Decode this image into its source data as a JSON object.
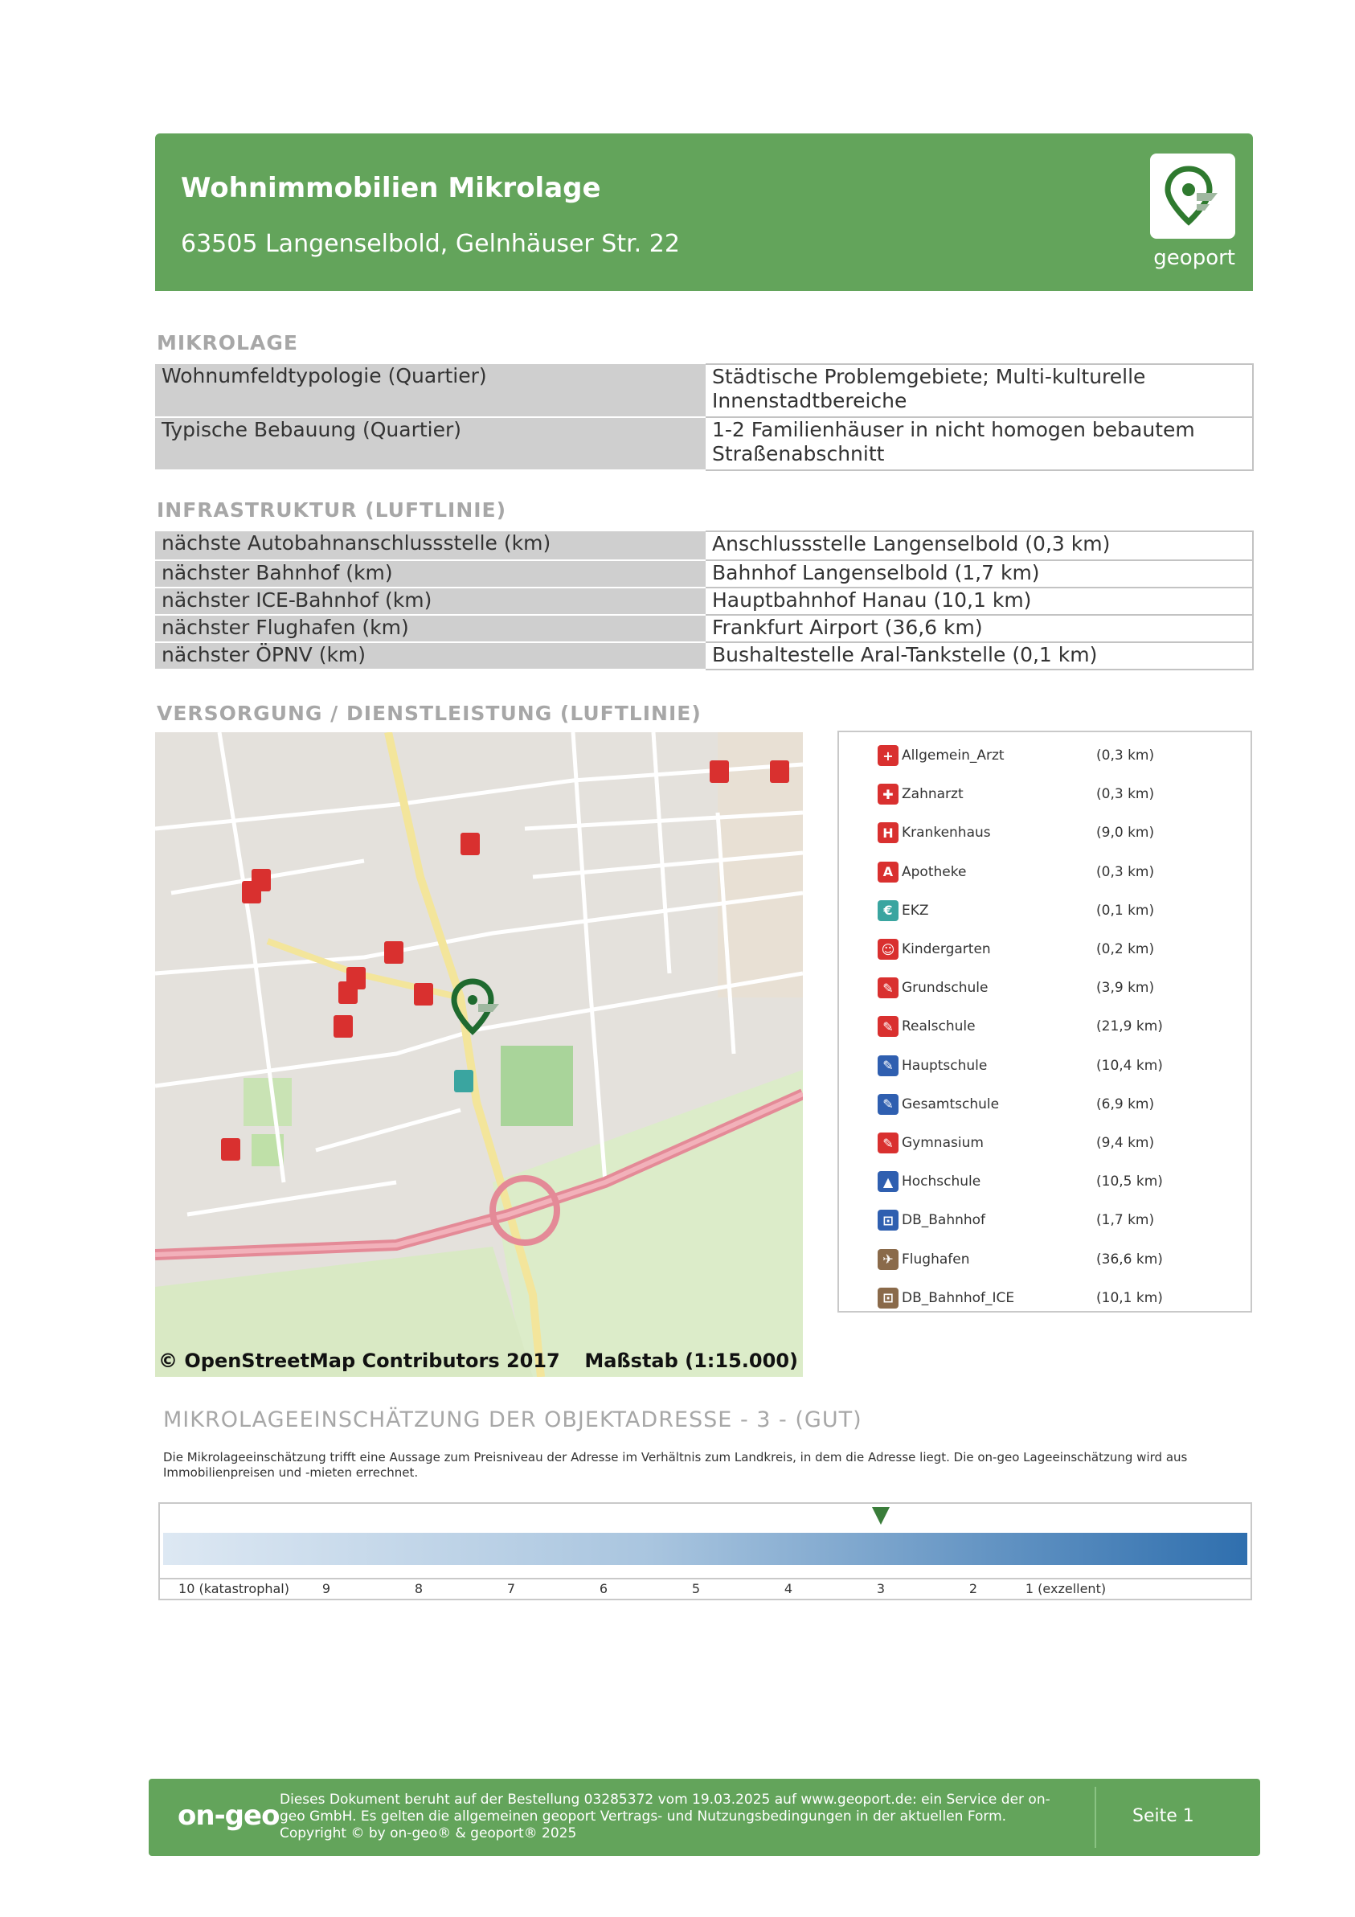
{
  "header": {
    "title": "Wohnimmobilien Mikrolage",
    "address": "63505 Langenselbold, Gelnhäuser Str. 22",
    "logo_text": "geoport",
    "logo_icon": "geoport-pin-icon",
    "color": "#63a45b"
  },
  "mikrolage": {
    "title": "MIKROLAGE",
    "rows": [
      {
        "label": "Wohnumfeldtypologie (Quartier)",
        "value": "Städtische Problemgebiete; Multi-kulturelle Innenstadtbereiche"
      },
      {
        "label": "Typische Bebauung (Quartier)",
        "value": "1-2 Familienhäuser in nicht homogen bebautem Straßenabschnitt"
      }
    ]
  },
  "infrastruktur": {
    "title": "INFRASTRUKTUR (LUFTLINIE)",
    "rows": [
      {
        "label": "nächste Autobahnanschlussstelle (km)",
        "value": "Anschlussstelle Langenselbold (0,3 km)"
      },
      {
        "label": "nächster Bahnhof (km)",
        "value": "Bahnhof Langenselbold (1,7 km)"
      },
      {
        "label": "nächster ICE-Bahnhof (km)",
        "value": "Hauptbahnhof Hanau (10,1 km)"
      },
      {
        "label": "nächster Flughafen (km)",
        "value": "Frankfurt Airport (36,6 km)"
      },
      {
        "label": "nächster ÖPNV (km)",
        "value": "Bushaltestelle Aral-Tankstelle (0,1 km)"
      }
    ]
  },
  "versorgung": {
    "title": "VERSORGUNG / DIENSTLEISTUNG (LUFTLINIE)",
    "map_credit": "© OpenStreetMap Contributors 2017",
    "map_scale": "Maßstab (1:15.000)",
    "legend": [
      {
        "name": "Allgemein_Arzt",
        "dist": "(0,3 km)",
        "icon": "doctor-icon",
        "color": "#d9302f"
      },
      {
        "name": "Zahnarzt",
        "dist": "(0,3 km)",
        "icon": "tooth-icon",
        "color": "#d9302f"
      },
      {
        "name": "Krankenhaus",
        "dist": "(9,0 km)",
        "icon": "hospital-icon",
        "color": "#d9302f"
      },
      {
        "name": "Apotheke",
        "dist": "(0,3 km)",
        "icon": "pharmacy-icon",
        "color": "#d9302f"
      },
      {
        "name": "EKZ",
        "dist": "(0,1 km)",
        "icon": "shopping-icon",
        "color": "#3aa5a0"
      },
      {
        "name": "Kindergarten",
        "dist": "(0,2 km)",
        "icon": "kindergarten-icon",
        "color": "#d9302f"
      },
      {
        "name": "Grundschule",
        "dist": "(3,9 km)",
        "icon": "school-icon",
        "color": "#d9302f"
      },
      {
        "name": "Realschule",
        "dist": "(21,9 km)",
        "icon": "school-icon",
        "color": "#d9302f"
      },
      {
        "name": "Hauptschule",
        "dist": "(10,4 km)",
        "icon": "school-icon",
        "color": "#2f5fb0"
      },
      {
        "name": "Gesamtschule",
        "dist": "(6,9 km)",
        "icon": "school-icon",
        "color": "#2f5fb0"
      },
      {
        "name": "Gymnasium",
        "dist": "(9,4 km)",
        "icon": "school-icon",
        "color": "#d9302f"
      },
      {
        "name": "Hochschule",
        "dist": "(10,5 km)",
        "icon": "university-icon",
        "color": "#2f5fb0"
      },
      {
        "name": "DB_Bahnhof",
        "dist": "(1,7 km)",
        "icon": "train-icon",
        "color": "#2f5fb0"
      },
      {
        "name": "Flughafen",
        "dist": "(36,6 km)",
        "icon": "airport-icon",
        "color": "#8a6a4a"
      },
      {
        "name": "DB_Bahnhof_ICE",
        "dist": "(10,1 km)",
        "icon": "train-icon",
        "color": "#8a6a4a"
      }
    ]
  },
  "rating": {
    "title": "MIKROLAGEEINSCHÄTZUNG DER OBJEKTADRESSE - 3 - (GUT)",
    "description": "Die Mikrolageeinschätzung trifft eine Aussage zum Preisniveau der Adresse im Verhältnis zum Landkreis, in dem die Adresse liegt. Die on-geo Lageeinschätzung wird aus Immobilienpreisen und -mieten errechnet.",
    "scale_labels": [
      "10 (katastrophal)",
      "9",
      "8",
      "7",
      "6",
      "5",
      "4",
      "3",
      "2",
      "1 (exzellent)"
    ],
    "value": 3
  },
  "footer": {
    "brand": "on-geo",
    "text": "Dieses Dokument beruht auf der Bestellung 03285372 vom 19.03.2025 auf www.geoport.de: ein Service der on-geo GmbH. Es gelten die allgemeinen geoport Vertrags- und Nutzungsbedingungen in der aktuellen Form. Copyright © by on-geo® & geoport® 2025",
    "page": "Seite 1"
  }
}
